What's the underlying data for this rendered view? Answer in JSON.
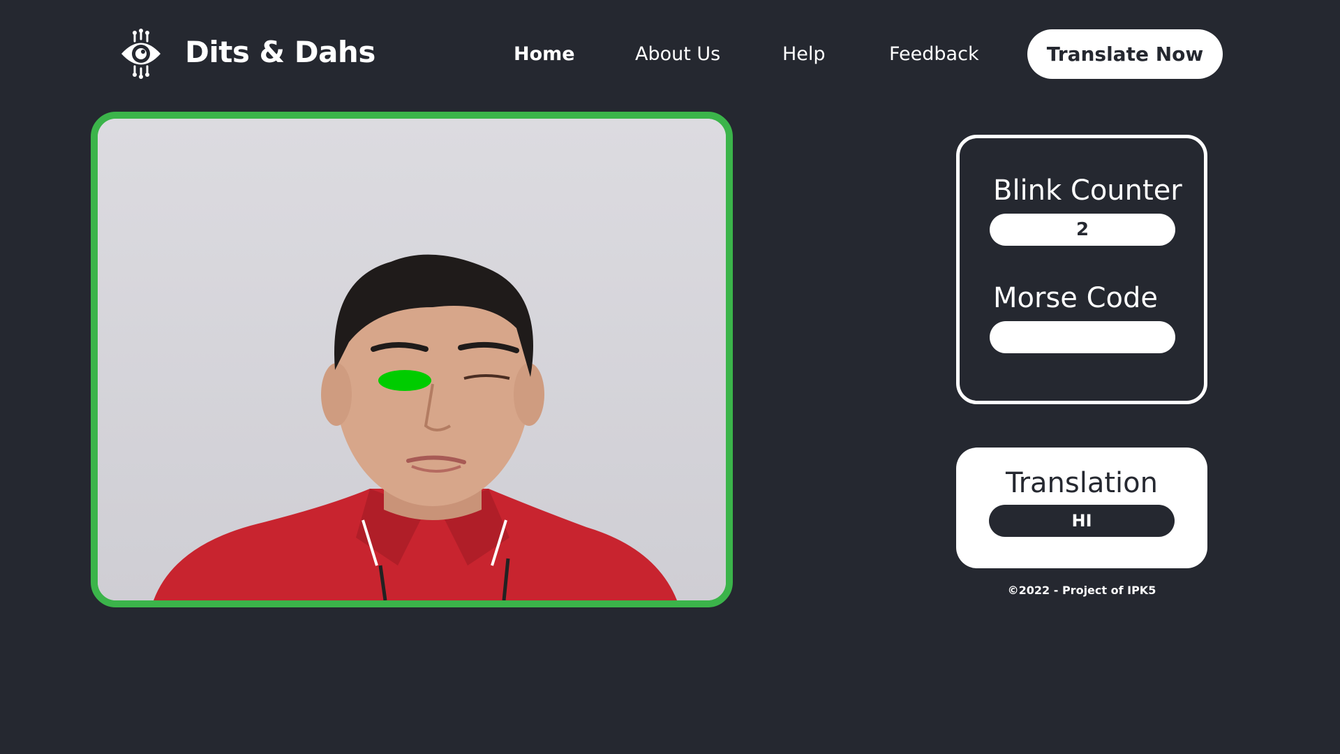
{
  "header": {
    "brand": "Dits & Dahs",
    "logo_icon": "eye-circuit-icon",
    "nav": [
      {
        "label": "Home",
        "active": true
      },
      {
        "label": "About Us"
      },
      {
        "label": "Help"
      },
      {
        "label": "Feedback"
      }
    ],
    "cta_label": "Translate Now"
  },
  "camera": {
    "border_color": "#3bb44a",
    "eye_marker_color": "#00cc00"
  },
  "stats_panel": {
    "blink_title": "Blink Counter",
    "blink_value": "2",
    "morse_title": "Morse Code",
    "morse_value": ""
  },
  "translation_panel": {
    "title": "Translation",
    "value": "HI"
  },
  "footer": {
    "text": "©2022 - Project of IPK5"
  },
  "colors": {
    "background": "#252830",
    "accent_green": "#3bb44a",
    "panel_white": "#ffffff"
  }
}
